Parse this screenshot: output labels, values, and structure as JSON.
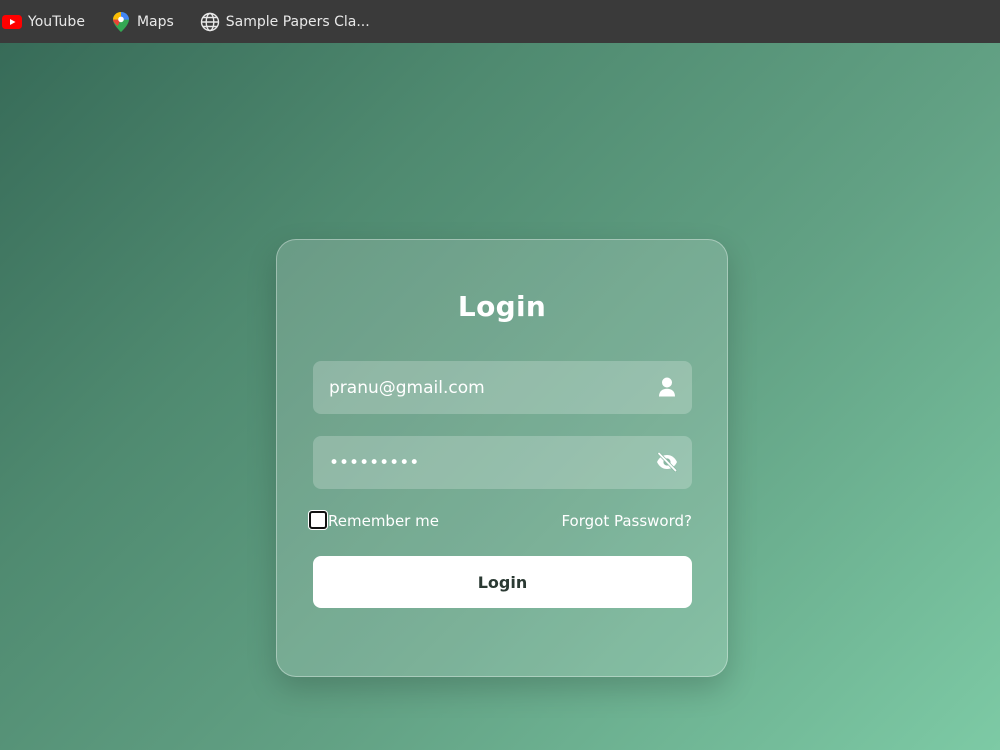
{
  "bookmarks": {
    "items": [
      {
        "label": "YouTube",
        "icon": "youtube-icon"
      },
      {
        "label": "Maps",
        "icon": "maps-icon"
      },
      {
        "label": "Sample Papers Cla...",
        "icon": "globe-icon"
      }
    ]
  },
  "login": {
    "title": "Login",
    "email": {
      "value": "pranu@gmail.com",
      "icon": "user-icon"
    },
    "password": {
      "value": "•••••••••",
      "icon": "eye-slash-icon"
    },
    "remember_label": "Remember me",
    "remember_checked": false,
    "forgot_label": "Forgot Password?",
    "button_label": "Login"
  },
  "colors": {
    "bookmarks_bar": "#3a3a3a",
    "background_start": "#376b58",
    "background_end": "#7dcaa5",
    "card_text": "#ffffff",
    "button_background": "#ffffff",
    "button_text": "#2b3a33",
    "youtube_red": "#ff0000"
  }
}
